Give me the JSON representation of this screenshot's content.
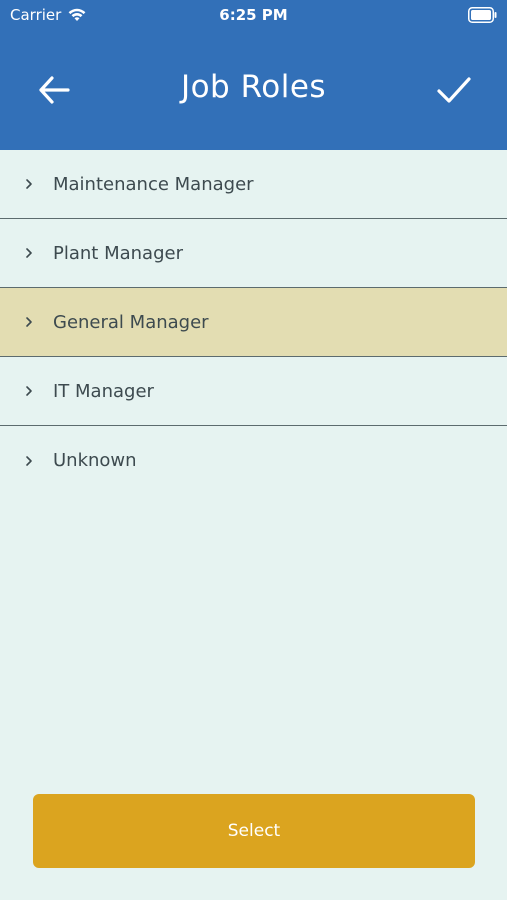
{
  "status_bar": {
    "carrier": "Carrier",
    "time": "6:25 PM"
  },
  "header": {
    "title": "Job Roles",
    "back_icon": "arrow-left-icon",
    "done_icon": "checkmark-icon"
  },
  "job_roles": [
    {
      "label": "Maintenance Manager",
      "selected": false
    },
    {
      "label": "Plant Manager",
      "selected": false
    },
    {
      "label": "General Manager",
      "selected": true
    },
    {
      "label": "IT Manager",
      "selected": false
    },
    {
      "label": "Unknown",
      "selected": false
    }
  ],
  "select_button": {
    "label": "Select"
  },
  "colors": {
    "header": "#3270B8",
    "background": "#E6F3F1",
    "selected_row": "#E3DDB2",
    "button": "#DBA41F",
    "text": "#3D4A4F"
  }
}
